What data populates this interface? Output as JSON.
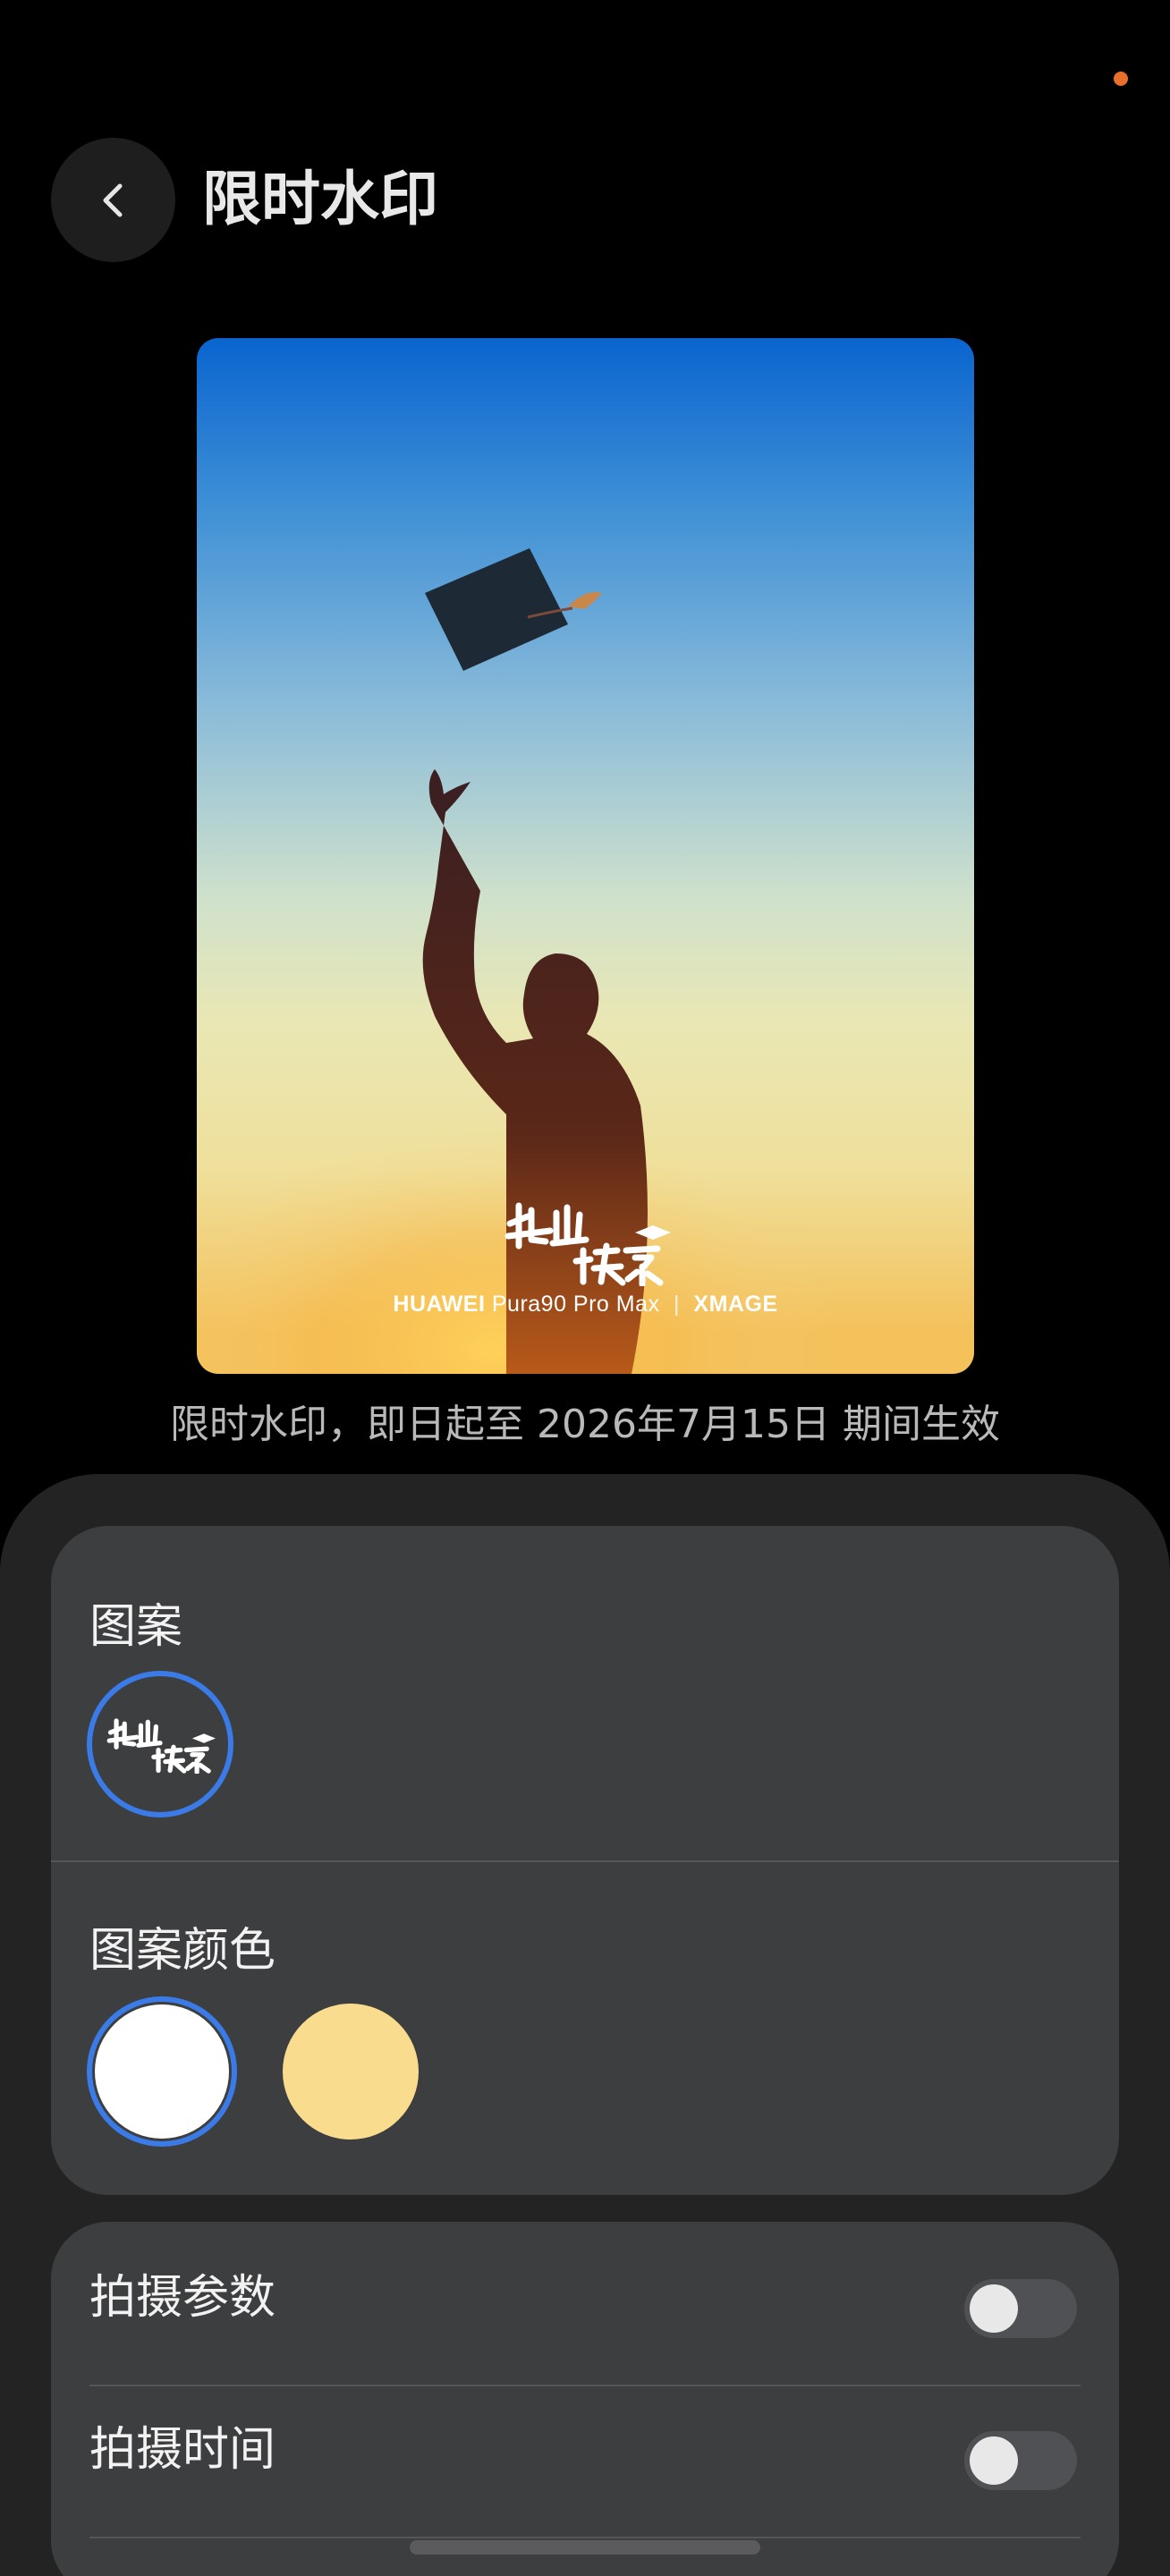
{
  "header": {
    "title": "限时水印",
    "back_label": "back"
  },
  "preview": {
    "watermark_logo_text": "毕业快乐",
    "caption_brand": "HUAWEI",
    "caption_model": "Pura90 Pro Max",
    "caption_separator": "|",
    "caption_xmage": "XMAGE"
  },
  "validity_text": "限时水印，即日起至 2026年7月15日 期间生效",
  "pattern_section": {
    "label": "图案",
    "options": [
      {
        "name": "毕业快乐",
        "selected": true
      }
    ]
  },
  "color_section": {
    "label": "图案颜色",
    "options": [
      {
        "color": "#ffffff",
        "selected": true
      },
      {
        "color": "#f9dc8e",
        "selected": false
      }
    ]
  },
  "settings": [
    {
      "label": "拍摄参数",
      "enabled": false
    },
    {
      "label": "拍摄时间",
      "enabled": false
    }
  ],
  "colors": {
    "accent": "#3b7be8",
    "status_dot": "#e8702a",
    "card_bg": "#3d3e40",
    "sheet_bg": "#232324"
  }
}
